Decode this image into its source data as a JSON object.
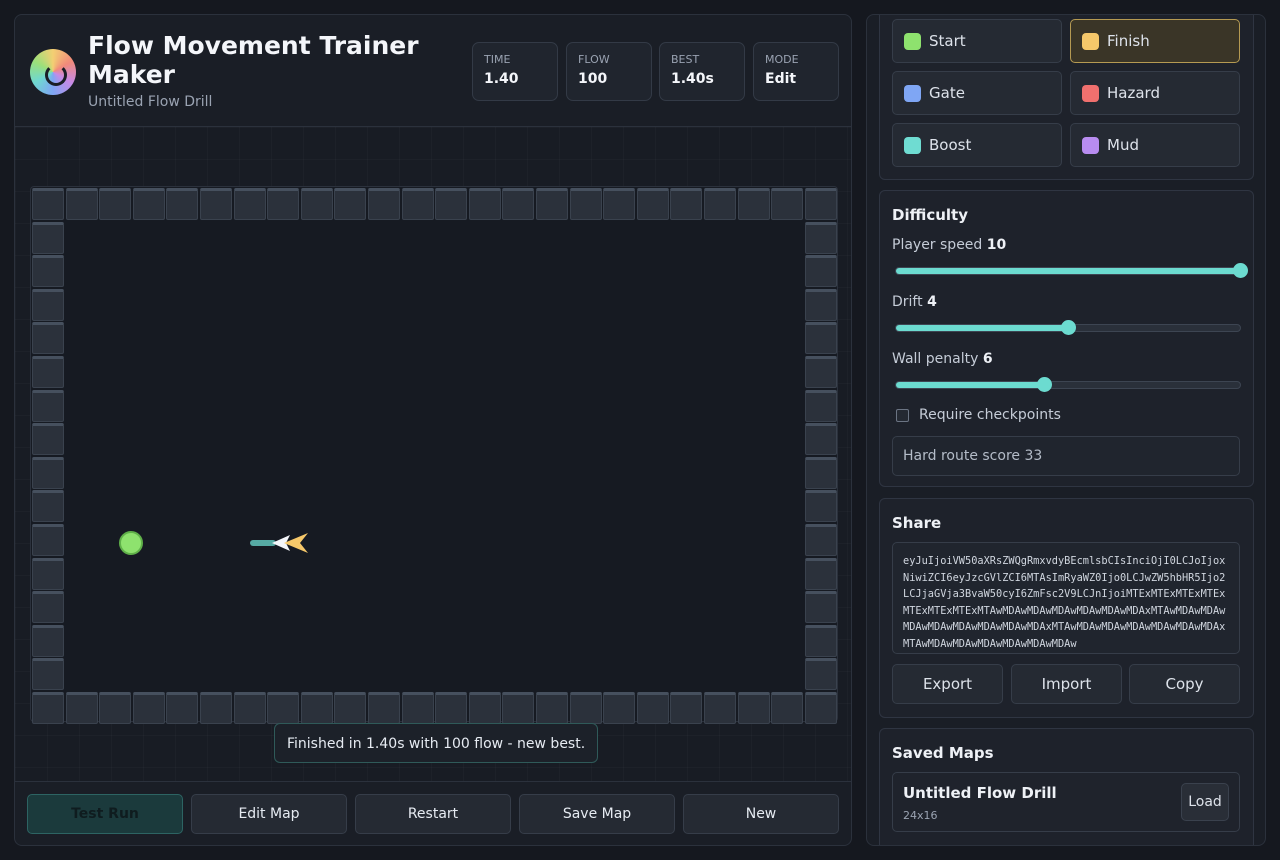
{
  "header": {
    "title": "Flow Movement Trainer Maker",
    "subtitle": "Untitled Flow Drill",
    "stats": [
      {
        "label": "TIME",
        "value": "1.40"
      },
      {
        "label": "FLOW",
        "value": "100"
      },
      {
        "label": "BEST",
        "value": "1.40s"
      },
      {
        "label": "MODE",
        "value": "Edit"
      }
    ]
  },
  "arena": {
    "toast": "Finished in 1.40s with 100 flow - new best."
  },
  "footer": {
    "buttons": [
      "Test Run",
      "Edit Map",
      "Restart",
      "Save Map",
      "New"
    ]
  },
  "tools": [
    {
      "label": "Start",
      "color": "#8ee26e"
    },
    {
      "label": "Finish",
      "color": "#f6c86a"
    },
    {
      "label": "Gate",
      "color": "#7fa6f4"
    },
    {
      "label": "Hazard",
      "color": "#f0706e"
    },
    {
      "label": "Boost",
      "color": "#6fdcd2"
    },
    {
      "label": "Mud",
      "color": "#b88cf0"
    }
  ],
  "difficulty": {
    "title": "Difficulty",
    "sliders": [
      {
        "label": "Player speed",
        "value": "10",
        "fraction": 1.0
      },
      {
        "label": "Drift",
        "value": "4",
        "fraction": 0.5
      },
      {
        "label": "Wall penalty",
        "value": "6",
        "fraction": 0.43
      }
    ],
    "checkbox_label": "Require checkpoints",
    "checkbox_checked": false,
    "score_text": "Hard route score 33"
  },
  "share": {
    "title": "Share",
    "code": "eyJuIjoiVW50aXRsZWQgRmxvdyBEcmlsbCIsInciOjI0LCJoIjoxNiwiZCI6eyJzcGVlZCI6MTAsImRyaWZ0Ijo0LCJwZW5hbHR5Ijo2LCJjaGVja3BvaW50cyI6ZmFsc2V9LCJnIjoiMTExMTExMTExMTExMTExMTExMTExMTAwMDAwMDAwMDAwMDAwMDAwMDAxMTAwMDAwMDAwMDAwMDAwMDAwMDAwMDAwMDAxMTAwMDAwMDAwMDAwMDAwMDAwMDAxMTAwMDAwMDAwMDAwMDAwMDAwMDAw",
    "buttons": [
      "Export",
      "Import",
      "Copy"
    ]
  },
  "saved": {
    "title": "Saved Maps",
    "items": [
      {
        "name": "Untitled Flow Drill",
        "size": "24x16",
        "button": "Load"
      }
    ]
  }
}
